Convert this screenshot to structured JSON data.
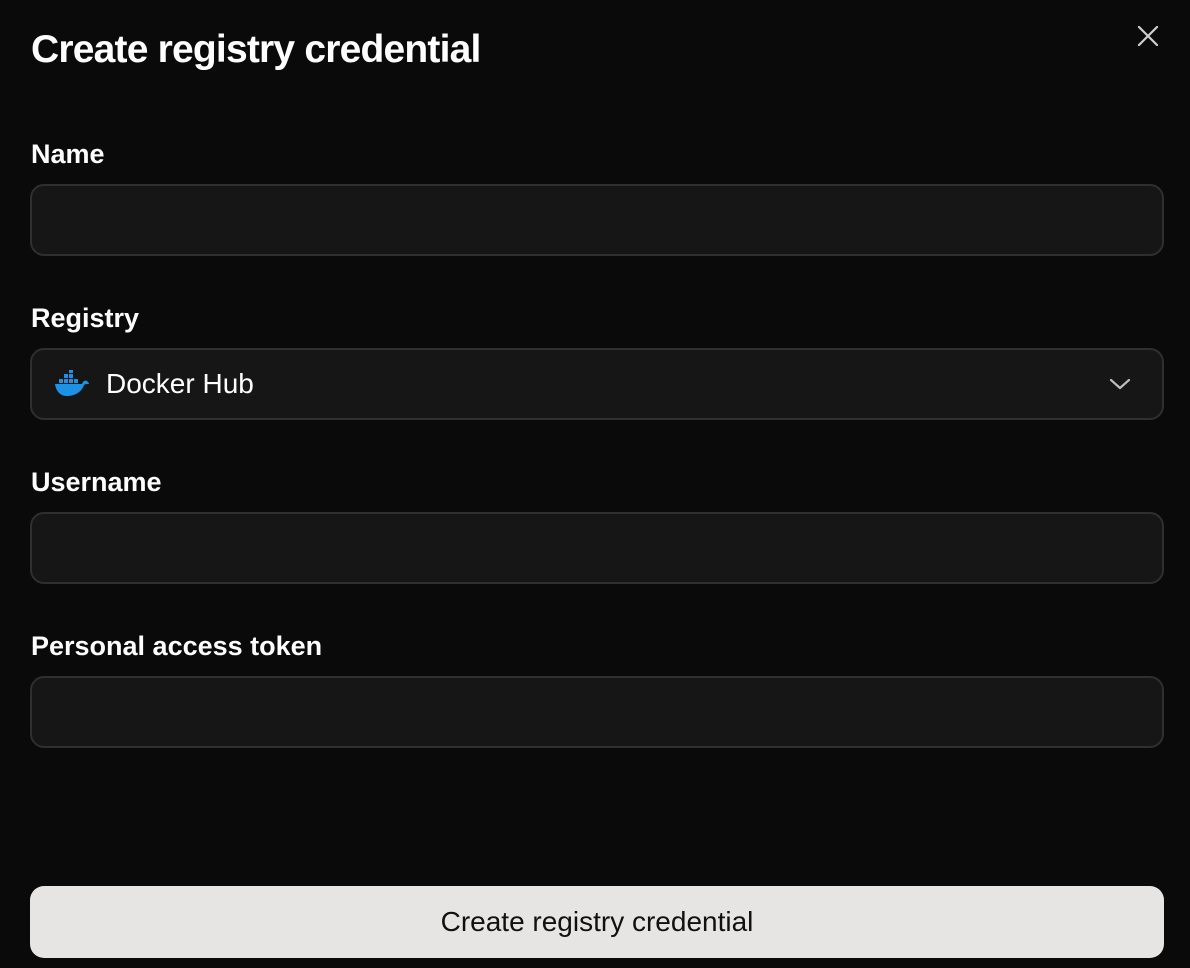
{
  "dialog": {
    "title": "Create registry credential",
    "close_icon": "close-icon"
  },
  "fields": {
    "name": {
      "label": "Name",
      "value": "",
      "placeholder": ""
    },
    "registry": {
      "label": "Registry",
      "value": "Docker Hub",
      "icon": "docker-icon",
      "chevron": "chevron-down-icon"
    },
    "username": {
      "label": "Username",
      "value": "",
      "placeholder": ""
    },
    "token": {
      "label": "Personal access token",
      "value": "",
      "placeholder": ""
    }
  },
  "submit": {
    "label": "Create registry credential"
  },
  "colors": {
    "background": "#0b0a0a",
    "input_bg": "#161616",
    "input_border": "#2f2f2f",
    "button_bg": "#e6e5e3",
    "docker_blue": "#1d91e6"
  }
}
